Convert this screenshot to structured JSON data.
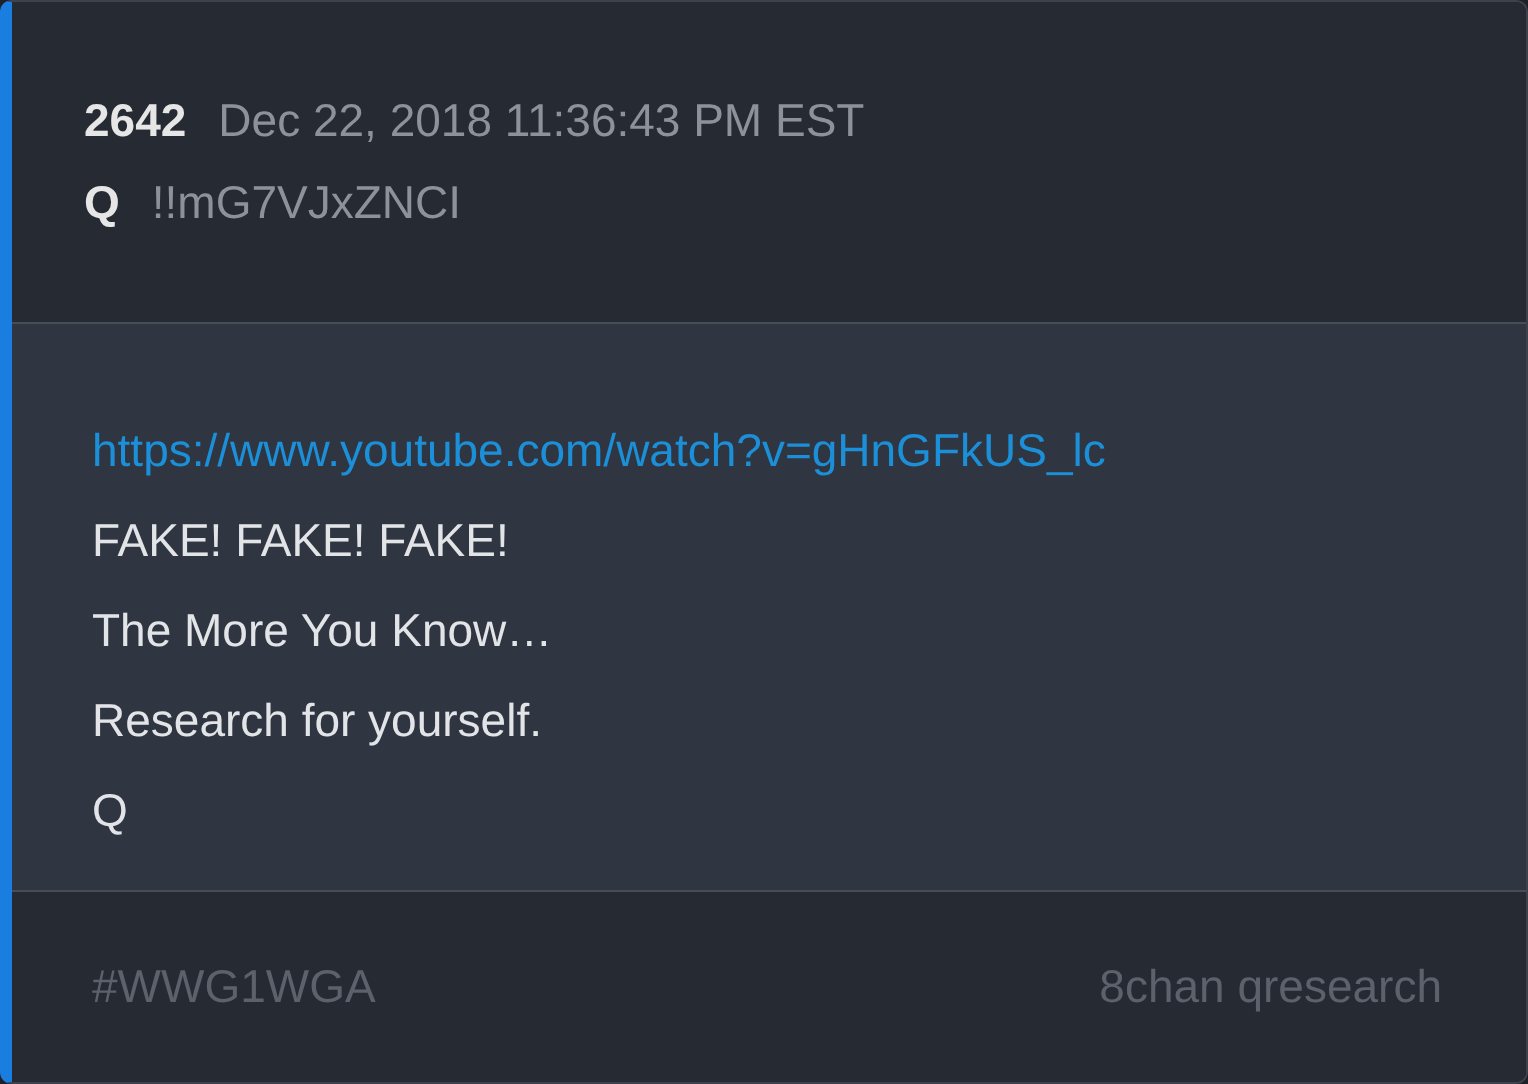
{
  "post": {
    "number": "2642",
    "timestamp": "Dec 22, 2018 11:36:43 PM EST",
    "author": "Q",
    "tripcode": "!!mG7VJxZNCI"
  },
  "body": [
    {
      "kind": "link",
      "text": "https://www.youtube.com/watch?v=gHnGFkUS_lc"
    },
    {
      "kind": "text",
      "text": "FAKE! FAKE! FAKE!"
    },
    {
      "kind": "text",
      "text": "The More You Know…"
    },
    {
      "kind": "text",
      "text": "Research for yourself."
    },
    {
      "kind": "text",
      "text": "Q"
    }
  ],
  "footer": {
    "hashtag": "#WWG1WGA",
    "source": "8chan qresearch"
  }
}
